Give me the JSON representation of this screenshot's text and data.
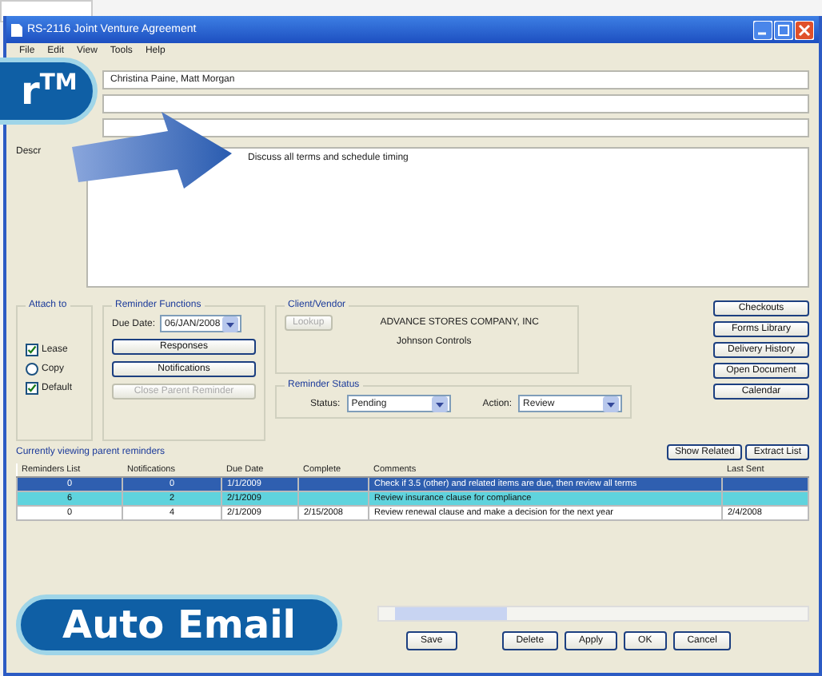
{
  "window": {
    "title": "RS-2116 Joint Venture Agreement"
  },
  "menu": [
    "File",
    "Edit",
    "View",
    "Tools",
    "Help"
  ],
  "fields": [
    {
      "value": "Christina Paine, Matt Morgan"
    }
  ],
  "notes": {
    "label": "Descr",
    "value": "Discuss all terms and schedule timing"
  },
  "attach_to": {
    "title": "Attach to",
    "options": [
      {
        "kind": "checkbox",
        "label": "Lease",
        "checked": true
      },
      {
        "kind": "radio",
        "label": "Copy",
        "checked": false
      },
      {
        "kind": "checkbox",
        "label": "Default",
        "checked": true
      }
    ]
  },
  "reminder_functions": {
    "title": "Reminder Functions",
    "due_label": "Due Date:",
    "due_value": "06/JAN/2008",
    "buttons": [
      {
        "label": "Responses",
        "disabled": false
      },
      {
        "label": "Notifications",
        "disabled": false
      },
      {
        "label": "Close Parent Reminder",
        "disabled": true
      }
    ]
  },
  "client": {
    "title": "Client/Vendor",
    "lookup": {
      "label": "Lookup",
      "disabled": true
    },
    "company": "ADVANCE STORES COMPANY, INC",
    "contact": "Johnson Controls"
  },
  "reminder_status": {
    "title": "Reminder Status",
    "status_label": "Status:",
    "status": "Pending",
    "action_label": "Action:",
    "action": "Review"
  },
  "side_buttons": [
    "Checkouts",
    "Forms Library",
    "Delivery History",
    "Open Document",
    "Calendar"
  ],
  "list_caption": "Currently viewing parent reminders",
  "list_buttons": [
    "Show Related",
    "Extract List"
  ],
  "table": {
    "columns": [
      "Reminders List",
      "Notifications",
      "Due Date",
      "Complete",
      "Comments",
      "Last Sent"
    ],
    "rows": [
      {
        "selected": true,
        "color": "#2f5fb0",
        "cells": [
          "0",
          "0",
          "1/1/2009",
          "",
          "Check if 3.5 (other) and related items are due, then review all terms",
          ""
        ]
      },
      {
        "selected": false,
        "color": "#5fd3dd",
        "cells": [
          "6",
          "2",
          "2/1/2009",
          "",
          "Review insurance clause for compliance",
          ""
        ]
      },
      {
        "selected": false,
        "color": "#ffffff",
        "cells": [
          "0",
          "4",
          "2/1/2009",
          "2/15/2008",
          "Review renewal clause and make a decision for the next year",
          "2/4/2008"
        ]
      }
    ]
  },
  "bottom_buttons": {
    "left": [
      "Save"
    ],
    "right": [
      "Delete",
      "Apply",
      "OK",
      "Cancel"
    ]
  },
  "badges": [
    {
      "kind": "top",
      "text": "r$^{TM}$"
    },
    {
      "kind": "bottom",
      "text": "Auto Email"
    }
  ]
}
